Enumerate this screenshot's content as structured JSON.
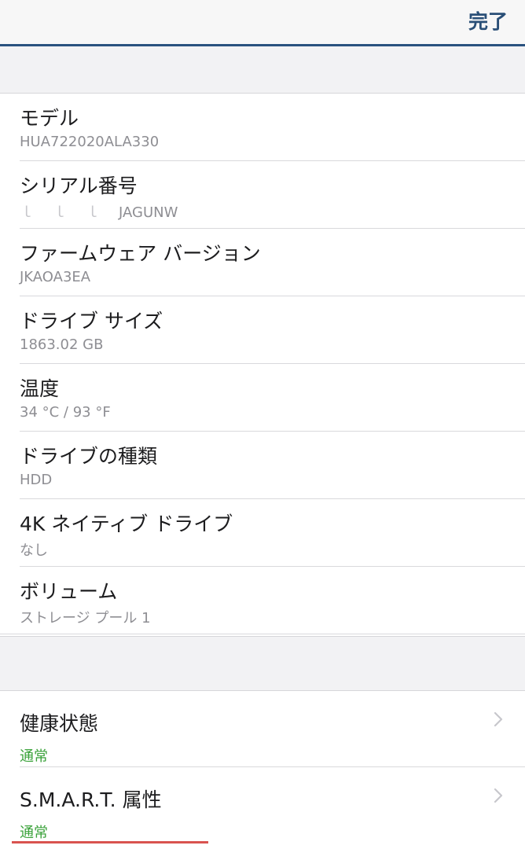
{
  "header": {
    "done_label": "完了"
  },
  "details": [
    {
      "title": "モデル",
      "value": "HUA722020ALA330"
    },
    {
      "title": "シリアル番号",
      "value": "JAGUNW"
    },
    {
      "title": "ファームウェア バージョン",
      "value": "JKAOA3EA"
    },
    {
      "title": "ドライブ サイズ",
      "value": "1863.02 GB"
    },
    {
      "title": "温度",
      "value": "34 °C / 93 °F"
    },
    {
      "title": "ドライブの種類",
      "value": "HDD"
    },
    {
      "title": "4K ネイティブ ドライブ",
      "value": "なし"
    },
    {
      "title": "ボリューム",
      "value": "ストレージ プール 1"
    }
  ],
  "status_rows": [
    {
      "title": "健康状態",
      "status": "通常"
    },
    {
      "title": "S.M.A.R.T. 属性",
      "status": "通常"
    }
  ],
  "colors": {
    "accent": "#2a527f",
    "status_ok": "#3aa23a"
  }
}
